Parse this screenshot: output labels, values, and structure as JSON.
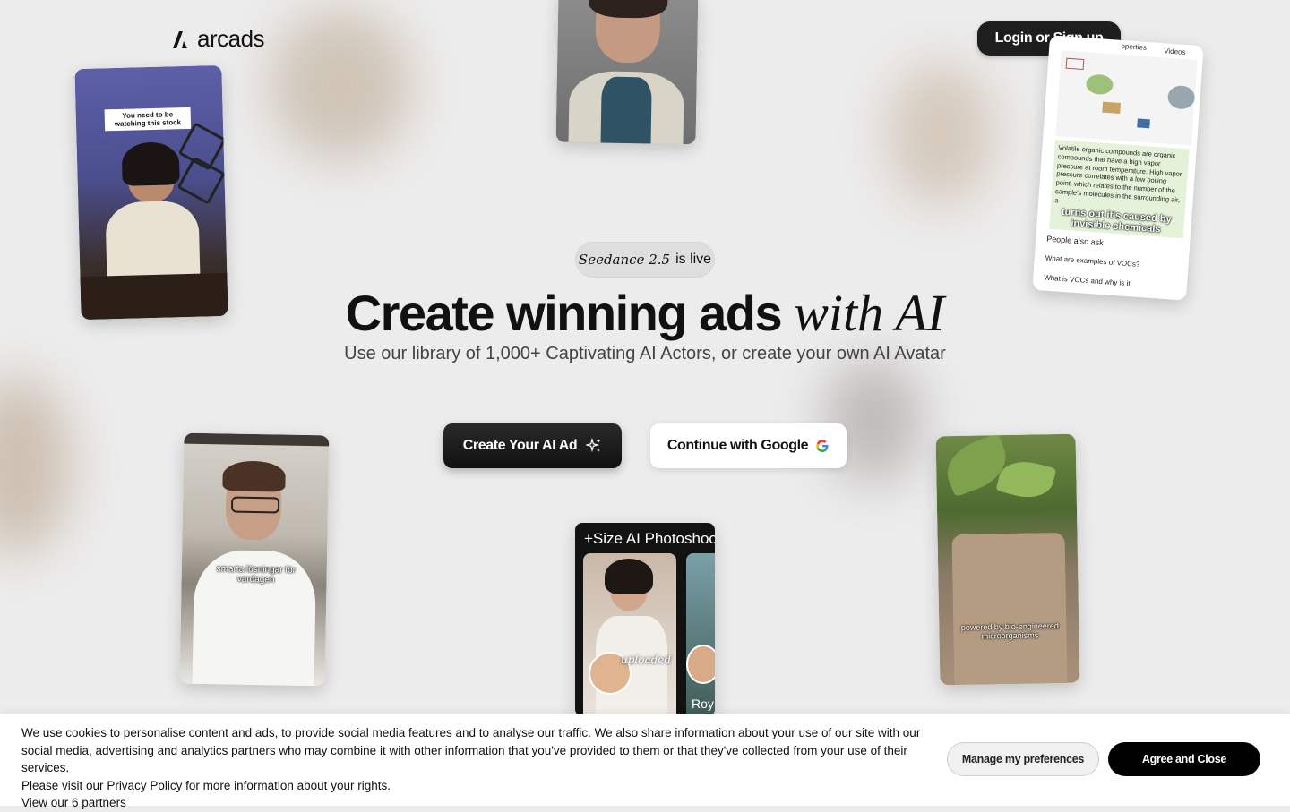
{
  "brand": {
    "name": "arcads",
    "icon": "arcads-logo-icon"
  },
  "header": {
    "login_label": "Login or Sign up"
  },
  "hero": {
    "badge_model": "Seedance 2.5",
    "badge_suffix": "is live",
    "title_main": "Create winning ads",
    "title_accent": "with AI",
    "subtitle": "Use our library of 1,000+ Captivating AI Actors, or create your own AI Avatar",
    "cta_primary": "Create Your AI Ad",
    "cta_primary_icon": "sparkles-icon",
    "cta_google": "Continue with Google",
    "cta_google_icon": "google-icon"
  },
  "showcase": {
    "card1_caption": "You need to be watching this stock",
    "card3_caption": "turns out it's caused by invisible chemicals",
    "card3_search_text": "Volatile organic compounds are organic compounds that have a high vapor pressure at room temperature. High vapor pressure correlates with a low boiling point, which relates to the number of the sample's molecules in the surrounding air, a",
    "card3_tab1": "operties",
    "card3_tab2": "Videos",
    "card3_people_also_ask": "People also ask",
    "card3_q1": "What are examples of VOCs?",
    "card3_q2": "What is VOCs and why is it",
    "card4_caption": "smarta lösningar för vardagen",
    "card5_title": "+Size AI Photoshoot",
    "card5_label_uploaded": "uploaded",
    "card5_label_roy": "Roy",
    "card6_caption": "powered by bio-engineered microorganisms"
  },
  "cookie": {
    "text": "We use cookies to personalise content and ads, to provide social media features and to analyse our traffic. We also share information about your use of our site with our social media, advertising and analytics partners who may combine it with other information that you've provided to them or that they've collected from your use of their services.",
    "privacy_prefix": "Please visit our",
    "privacy_link": "Privacy Policy",
    "privacy_suffix": "for more information about your rights.",
    "partners_link": "View our 6 partners",
    "manage_label": "Manage my preferences",
    "agree_label": "Agree and Close"
  }
}
